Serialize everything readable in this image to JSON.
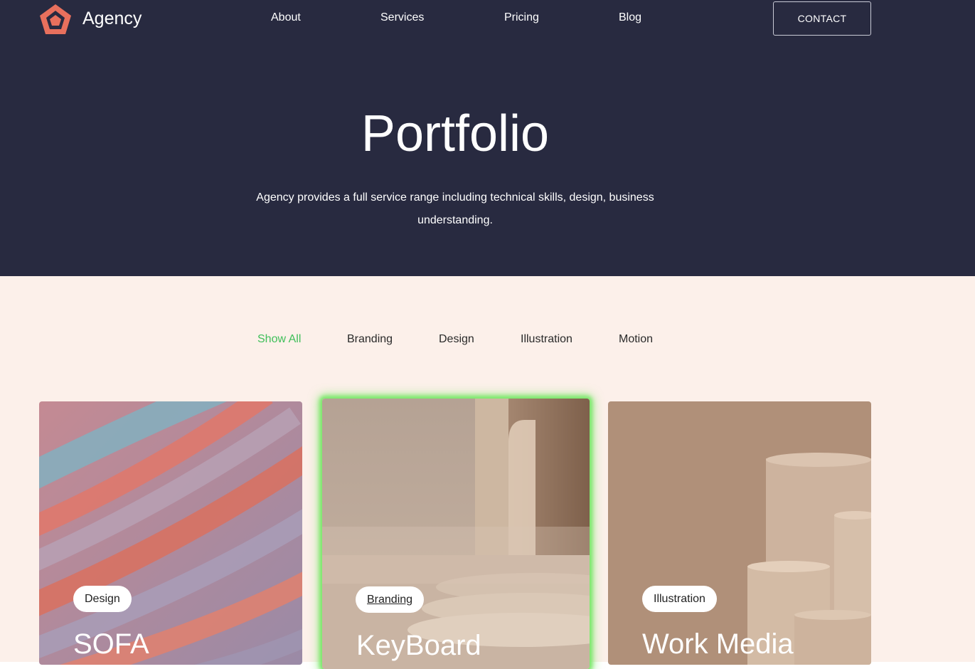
{
  "header": {
    "brand": "Agency",
    "nav": [
      "About",
      "Services",
      "Pricing",
      "Blog"
    ],
    "contact_label": "CONTACT"
  },
  "hero": {
    "title": "Portfolio",
    "subtitle": "Agency provides a full service range including technical skills, design, business understanding."
  },
  "filters": {
    "items": [
      "Show All",
      "Branding",
      "Design",
      "Illustration",
      "Motion"
    ],
    "active": "Show All"
  },
  "cards": [
    {
      "tag": "Design",
      "title": "SOFA"
    },
    {
      "tag": "Branding",
      "title": "KeyBoard"
    },
    {
      "tag": "Illustration",
      "title": "Work Media"
    }
  ],
  "colors": {
    "header_bg": "#282a40",
    "content_bg": "#fcf0ea",
    "accent": "#e8705d",
    "active_filter": "#3fbf5a",
    "highlight_glow": "#7be86b"
  },
  "icons": {
    "logo": "pentagon-logo-icon"
  }
}
